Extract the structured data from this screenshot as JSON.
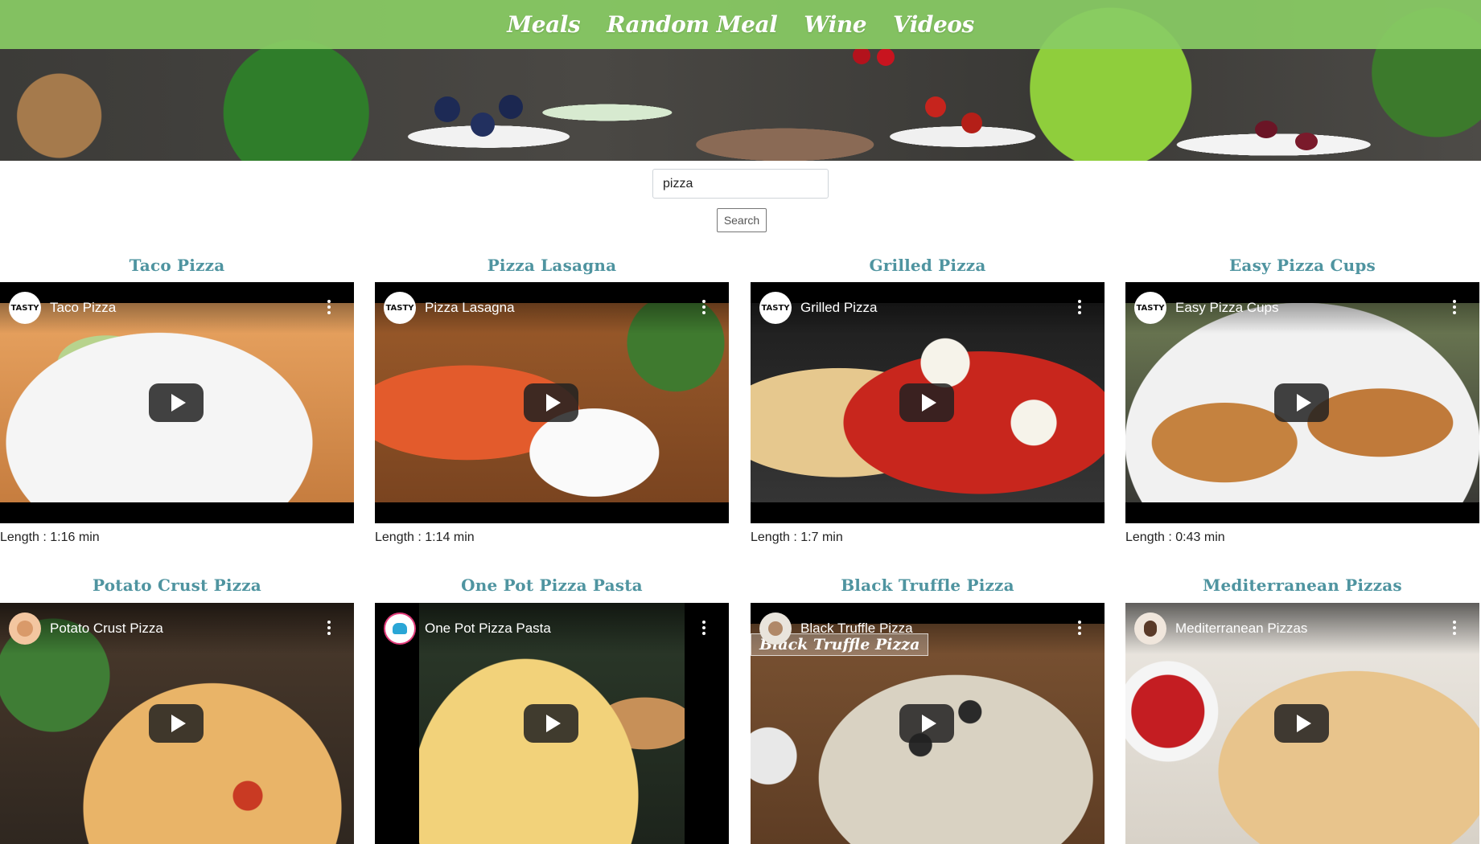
{
  "nav": {
    "items": [
      "Meals",
      "Random Meal",
      "Wine",
      "Videos"
    ]
  },
  "search": {
    "value": "pizza",
    "button_label": "Search"
  },
  "length_prefix": "Length : ",
  "cards": [
    {
      "title": "Taco Pizza",
      "video_title": "Taco Pizza",
      "channel_avatar_text": "TASTY",
      "length": "Length : 1:16 min"
    },
    {
      "title": "Pizza Lasagna",
      "video_title": "Pizza Lasagna",
      "channel_avatar_text": "TASTY",
      "length": "Length : 1:14 min"
    },
    {
      "title": "Grilled Pizza",
      "video_title": "Grilled Pizza",
      "channel_avatar_text": "TASTY",
      "length": "Length : 1:7 min"
    },
    {
      "title": "Easy Pizza Cups",
      "video_title": "Easy Pizza Cups",
      "channel_avatar_text": "TASTY",
      "length": "Length : 0:43 min"
    },
    {
      "title": "Potato Crust Pizza",
      "video_title": "Potato Crust Pizza",
      "channel_avatar_text": "",
      "length": ""
    },
    {
      "title": "One Pot Pizza Pasta",
      "video_title": "One Pot Pizza Pasta",
      "channel_avatar_text": "",
      "length": ""
    },
    {
      "title": "Black Truffle Pizza",
      "video_title": "Black Truffle Pizza",
      "channel_avatar_text": "",
      "length": "",
      "overlay_text": "Black Truffle Pizza"
    },
    {
      "title": "Mediterranean Pizzas",
      "video_title": "Mediterranean Pizzas",
      "channel_avatar_text": "",
      "length": ""
    }
  ],
  "colors": {
    "nav_bar": "#89cb64",
    "card_title": "#4f94a0"
  }
}
